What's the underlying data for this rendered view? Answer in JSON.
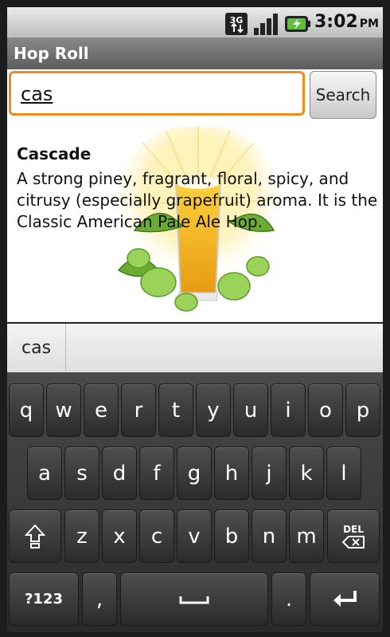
{
  "status_bar": {
    "network": "3G",
    "time": "3:02",
    "ampm": "PM"
  },
  "app": {
    "title": "Hop Roll"
  },
  "search": {
    "value": "cas",
    "button_label": "Search"
  },
  "result": {
    "name": "Cascade",
    "description": "A strong piney, fragrant, floral, spicy, and citrusy (especially grapefruit) aroma.  It is the Classic American Pale Ale Hop."
  },
  "suggestions": [
    "cas"
  ],
  "keyboard": {
    "row1": [
      "q",
      "w",
      "e",
      "r",
      "t",
      "y",
      "u",
      "i",
      "o",
      "p"
    ],
    "row2": [
      "a",
      "s",
      "d",
      "f",
      "g",
      "h",
      "j",
      "k",
      "l"
    ],
    "row3": [
      "z",
      "x",
      "c",
      "v",
      "b",
      "n",
      "m"
    ],
    "del_label": "DEL",
    "sym_label": "?123",
    "comma": ",",
    "period": "."
  },
  "colors": {
    "accent": "#f08a1a"
  }
}
